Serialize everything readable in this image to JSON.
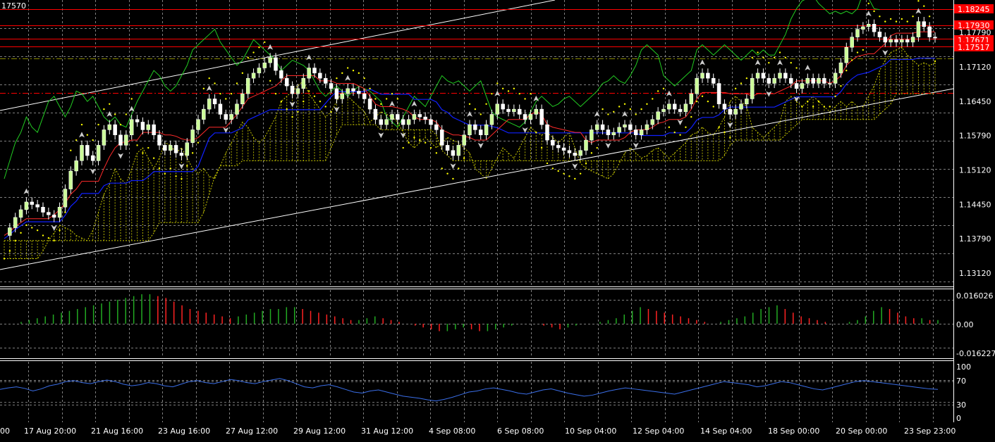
{
  "window": {
    "corner_label": "17570"
  },
  "colors": {
    "background": "#000000",
    "grid": "#7f7f7f",
    "text": "#ffffff",
    "resistance_line": "#ff0000",
    "price_box": "#ff0000",
    "tenkan": "#ff2a2a",
    "kijun": "#1020ff",
    "chikou": "#22cc22",
    "cloud": "#cccc00",
    "parabolic_sar": "#ffff00",
    "candle_up": "#ccff99",
    "candle_down": "#ffffff",
    "channel": "#ffffff",
    "osc_up": "#22aa22",
    "osc_down": "#ff2222",
    "rsi": "#3a6ee8"
  },
  "price_axis": {
    "ticks": [
      "1.17790",
      "1.17120",
      "1.16450",
      "1.15790",
      "1.15120",
      "1.14450",
      "1.13790",
      "1.13120"
    ]
  },
  "price_boxes": [
    "1.18245",
    "1.17930",
    "1.17671",
    "1.17517"
  ],
  "oscillator_axis": {
    "ticks": [
      "0.016026",
      "0.00",
      "-0.016227"
    ]
  },
  "rsi_axis": {
    "ticks": [
      "100",
      "70",
      "30",
      "0"
    ]
  },
  "time_axis": {
    "labels": [
      "00",
      "17 Aug 20:00",
      "21 Aug 16:00",
      "23 Aug 16:00",
      "27 Aug 12:00",
      "29 Aug 12:00",
      "31 Aug 12:00",
      "4 Sep 08:00",
      "6 Sep 08:00",
      "10 Sep 04:00",
      "12 Sep 04:00",
      "14 Sep 04:00",
      "18 Sep 00:00",
      "20 Sep 00:00",
      "23 Sep 23:00"
    ]
  },
  "price_closes": [
    1.1385,
    1.14,
    1.142,
    1.1435,
    1.145,
    1.1445,
    1.144,
    1.143,
    1.1425,
    1.142,
    1.144,
    1.1475,
    1.151,
    1.153,
    1.156,
    1.154,
    1.153,
    1.156,
    1.159,
    1.16,
    1.158,
    1.156,
    1.158,
    1.161,
    1.1605,
    1.159,
    1.16,
    1.158,
    1.156,
    1.155,
    1.156,
    1.1545,
    1.154,
    1.1565,
    1.159,
    1.161,
    1.163,
    1.165,
    1.164,
    1.162,
    1.161,
    1.162,
    1.164,
    1.166,
    1.169,
    1.17,
    1.171,
    1.172,
    1.173,
    1.1705,
    1.169,
    1.1675,
    1.166,
    1.167,
    1.169,
    1.171,
    1.17,
    1.169,
    1.168,
    1.167,
    1.165,
    1.166,
    1.167,
    1.1665,
    1.166,
    1.165,
    1.163,
    1.161,
    1.16,
    1.161,
    1.162,
    1.161,
    1.16,
    1.161,
    1.162,
    1.1615,
    1.161,
    1.16,
    1.159,
    1.156,
    1.155,
    1.154,
    1.156,
    1.158,
    1.16,
    1.159,
    1.158,
    1.16,
    1.162,
    1.164,
    1.163,
    1.1625,
    1.163,
    1.162,
    1.161,
    1.162,
    1.163,
    1.16,
    1.157,
    1.156,
    1.1555,
    1.155,
    1.1545,
    1.154,
    1.155,
    1.157,
    1.159,
    1.16,
    1.159,
    1.158,
    1.1585,
    1.1595,
    1.16,
    1.159,
    1.158,
    1.159,
    1.16,
    1.161,
    1.1625,
    1.163,
    1.164,
    1.163,
    1.1625,
    1.164,
    1.166,
    1.169,
    1.17,
    1.169,
    1.168,
    1.164,
    1.163,
    1.162,
    1.163,
    1.164,
    1.165,
    1.169,
    1.17,
    1.169,
    1.168,
    1.169,
    1.17,
    1.169,
    1.168,
    1.167,
    1.168,
    1.169,
    1.168,
    1.169,
    1.168,
    1.168,
    1.17,
    1.172,
    1.175,
    1.177,
    1.1785,
    1.179,
    1.1795,
    1.178,
    1.177,
    1.176,
    1.1765,
    1.176,
    1.1765,
    1.176,
    1.177,
    1.18,
    1.179,
    1.177,
    1.1768
  ],
  "oscillator_values": [
    0.001,
    0.002,
    0.003,
    0.004,
    0.005,
    0.006,
    0.007,
    0.008,
    0.009,
    0.01,
    0.011,
    0.012,
    0.013,
    0.014,
    0.015,
    0.016,
    0.016,
    0.015,
    0.014,
    0.012,
    0.01,
    0.008,
    0.007,
    0.006,
    0.005,
    0.004,
    0.003,
    0.004,
    0.005,
    0.006,
    0.007,
    0.008,
    0.008,
    0.009,
    0.009,
    0.008,
    0.007,
    0.006,
    0.005,
    0.004,
    0.003,
    0.002,
    0.002,
    0.003,
    0.004,
    0.003,
    0.002,
    0.001,
    0.0,
    -0.001,
    -0.002,
    -0.003,
    -0.004,
    -0.004,
    -0.003,
    -0.002,
    -0.003,
    -0.004,
    -0.004,
    -0.003,
    -0.002,
    -0.001,
    0.0,
    0.0,
    0.0,
    -0.001,
    -0.002,
    -0.003,
    -0.002,
    -0.001,
    0.0,
    0.0,
    0.001,
    0.002,
    0.003,
    0.005,
    0.007,
    0.009,
    0.008,
    0.007,
    0.006,
    0.005,
    0.004,
    0.003,
    0.002,
    0.001,
    0.0,
    0.001,
    0.002,
    0.003,
    0.004,
    0.006,
    0.008,
    0.009,
    0.01,
    0.008,
    0.006,
    0.004,
    0.003,
    0.002,
    0.001,
    0.0,
    0.0,
    0.001,
    0.002,
    0.004,
    0.007,
    0.009,
    0.008,
    0.006,
    0.004,
    0.003,
    0.003,
    0.002,
    0.002
  ],
  "rsi_values": [
    55,
    58,
    60,
    57,
    52,
    56,
    62,
    65,
    70,
    72,
    68,
    66,
    70,
    73,
    70,
    65,
    62,
    64,
    68,
    66,
    62,
    60,
    65,
    70,
    72,
    68,
    66,
    70,
    74,
    72,
    68,
    66,
    70,
    73,
    76,
    72,
    66,
    60,
    58,
    62,
    64,
    60,
    55,
    50,
    48,
    52,
    54,
    50,
    46,
    42,
    40,
    38,
    35,
    33,
    36,
    40,
    45,
    50,
    52,
    56,
    58,
    55,
    52,
    48,
    46,
    50,
    54,
    56,
    52,
    48,
    45,
    42,
    44,
    48,
    52,
    55,
    58,
    56,
    54,
    52,
    50,
    48,
    46,
    50,
    54,
    58,
    62,
    66,
    70,
    68,
    66,
    64,
    60,
    62,
    66,
    70,
    68,
    64,
    60,
    56,
    54,
    58,
    62,
    66,
    70,
    72,
    70,
    68,
    66,
    64,
    62,
    60,
    58,
    56,
    55
  ]
}
